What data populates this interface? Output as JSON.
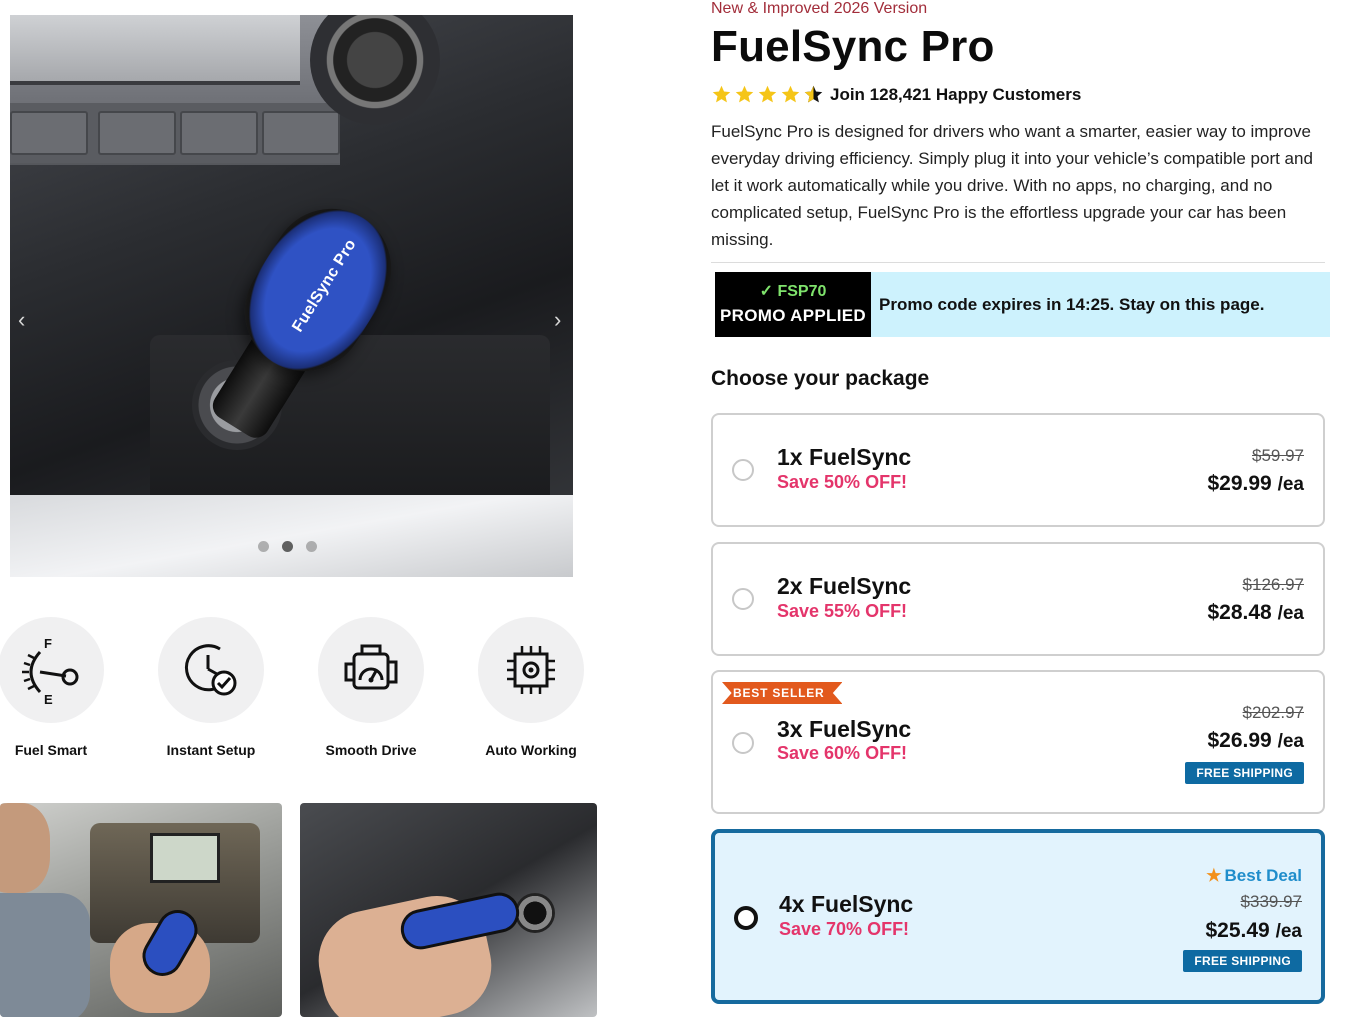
{
  "gallery": {
    "hero_device_brand": "FuelSync Pro",
    "arrows": {
      "prev": "‹",
      "next": "›"
    },
    "dot_count": 3,
    "active_dot": 2
  },
  "features": [
    {
      "label": "Fuel Smart",
      "icon": "fuel-gauge-icon"
    },
    {
      "label": "Instant Setup",
      "icon": "clock-check-icon"
    },
    {
      "label": "Smooth Drive",
      "icon": "engine-icon"
    },
    {
      "label": "Auto Working",
      "icon": "chip-icon"
    }
  ],
  "product": {
    "eyebrow": "New & Improved 2026 Version",
    "title": "FuelSync Pro",
    "rating": {
      "value": 4.5,
      "max": 5,
      "text": "Join 128,421 Happy Customers"
    },
    "description": "FuelSync Pro is designed for drivers who want a smarter, easier way to improve everyday driving efficiency. Simply plug it into your vehicle’s compatible port and let it work automatically while you drive. With no apps, no charging, and no complicated setup, FuelSync Pro is the effortless upgrade your car has been missing."
  },
  "promo": {
    "code_line": "✓ FSP70",
    "status": "PROMO APPLIED",
    "message": "Promo code expires in 14:25. Stay on this page."
  },
  "packages": {
    "heading": "Choose your package",
    "items": [
      {
        "name": "1x FuelSync",
        "save": "Save 50% OFF!",
        "old_price": "$59.97",
        "price": "$29.99",
        "unit": "/ea",
        "badge": "",
        "shipping": "",
        "highlight": "",
        "selected": false
      },
      {
        "name": "2x FuelSync",
        "save": "Save 55% OFF!",
        "old_price": "$126.97",
        "price": "$28.48",
        "unit": "/ea",
        "badge": "",
        "shipping": "",
        "highlight": "",
        "selected": false
      },
      {
        "name": "3x FuelSync",
        "save": "Save 60% OFF!",
        "old_price": "$202.97",
        "price": "$26.99",
        "unit": "/ea",
        "badge": "BEST SELLER",
        "shipping": "FREE SHIPPING",
        "highlight": "",
        "selected": false
      },
      {
        "name": "4x FuelSync",
        "save": "Save 70% OFF!",
        "old_price": "$339.97",
        "price": "$25.49",
        "unit": "/ea",
        "badge": "",
        "shipping": "FREE SHIPPING",
        "highlight": "Best Deal",
        "selected": true
      }
    ]
  },
  "colors": {
    "accent_blue": "#166a9e",
    "save_pink": "#e4356b",
    "eyebrow_red": "#a22d3a",
    "promo_bg": "#cdf2fd",
    "ribbon_orange": "#e2591d",
    "star_gold": "#f5c518"
  }
}
